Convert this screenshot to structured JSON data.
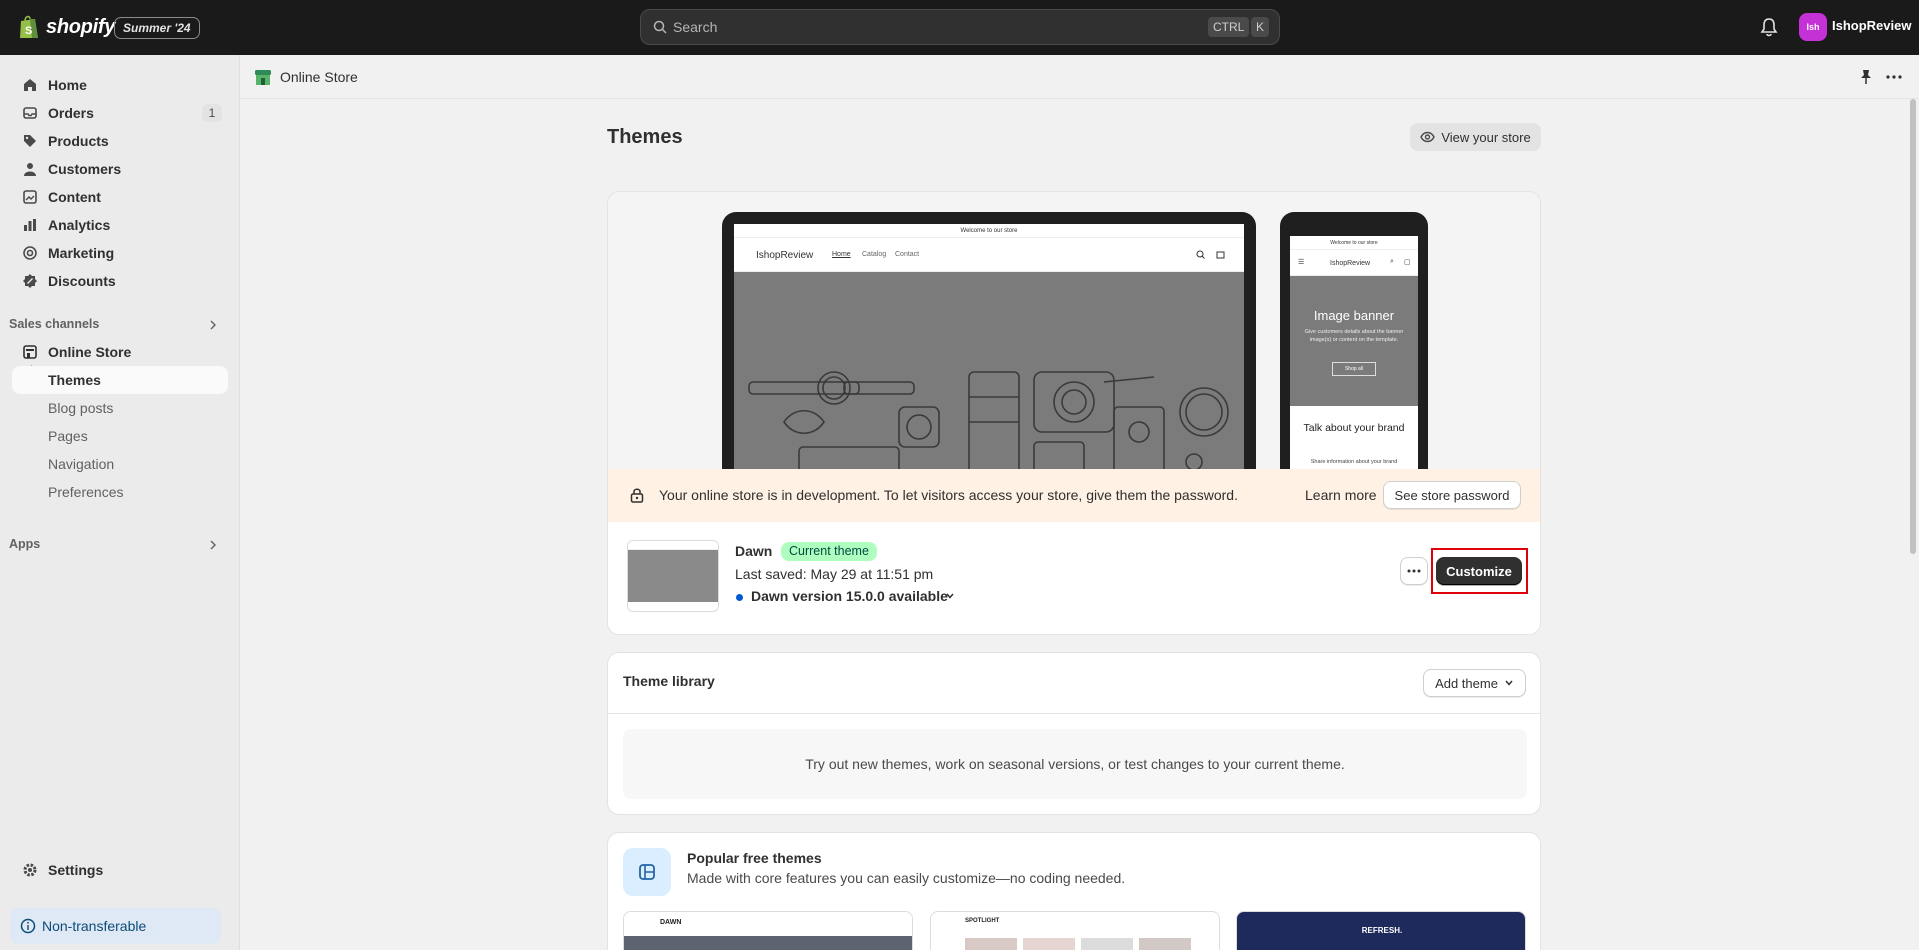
{
  "topbar": {
    "brand": "shopify",
    "edition": "Summer '24",
    "search_placeholder": "Search",
    "kbd_ctrl": "CTRL",
    "kbd_k": "K",
    "avatar_initials": "Ish",
    "store_name": "IshopReview"
  },
  "sidebar": {
    "items": [
      {
        "label": "Home",
        "icon": "home-icon"
      },
      {
        "label": "Orders",
        "icon": "orders-icon",
        "badge": "1"
      },
      {
        "label": "Products",
        "icon": "tag-icon"
      },
      {
        "label": "Customers",
        "icon": "person-icon"
      },
      {
        "label": "Content",
        "icon": "content-icon"
      },
      {
        "label": "Analytics",
        "icon": "bar-chart-icon"
      },
      {
        "label": "Marketing",
        "icon": "target-icon"
      },
      {
        "label": "Discounts",
        "icon": "discount-icon"
      }
    ],
    "sales_channels_title": "Sales channels",
    "online_store": "Online Store",
    "sub_items": [
      "Themes",
      "Blog posts",
      "Pages",
      "Navigation",
      "Preferences"
    ],
    "apps_title": "Apps",
    "settings": "Settings",
    "non_transferable": "Non-transferable"
  },
  "pagebar": {
    "title": "Online Store"
  },
  "main": {
    "title": "Themes",
    "view_store": "View your store",
    "preview": {
      "laptop_announcement": "Welcome to our store",
      "laptop_store": "IshopReview",
      "laptop_nav": [
        "Home",
        "Catalog",
        "Contact"
      ],
      "phone_announcement": "Welcome to our store",
      "phone_store": "IshopReview",
      "phone_banner_title": "Image banner",
      "phone_banner_text": "Give customers details about the banner image(s) or content on the template.",
      "phone_banner_button": "Shop all",
      "phone_brand_title": "Talk about your brand",
      "phone_brand_text": "Share information about your brand"
    },
    "dev_banner": {
      "text": "Your online store is in development. To let visitors access your store, give them the password.",
      "learn_more": "Learn more",
      "button": "See store password"
    },
    "current_theme": {
      "name": "Dawn",
      "badge": "Current theme",
      "last_saved": "Last saved: May 29 at 11:51 pm",
      "version": "Dawn version 15.0.0 available",
      "customize": "Customize"
    },
    "library": {
      "title": "Theme library",
      "add_theme": "Add theme",
      "empty_text": "Try out new themes, work on seasonal versions, or test changes to your current theme."
    },
    "popular": {
      "title": "Popular free themes",
      "subtitle": "Made with core features you can easily customize—no coding needed.",
      "themes": [
        "DAWN",
        "SPOTLIGHT",
        "REFRESH."
      ]
    }
  },
  "colors": {
    "topbar": "#1a1a1a",
    "accent_badge": "#affebf",
    "banner": "#fff1e3",
    "highlight": "#e0000b",
    "avatar": "#c431d6"
  }
}
